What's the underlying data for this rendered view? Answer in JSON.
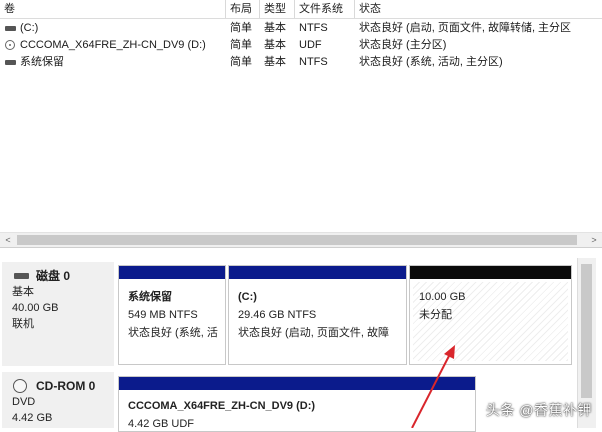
{
  "columns": [
    "卷",
    "布局",
    "类型",
    "文件系统",
    "状态"
  ],
  "volumes": [
    {
      "name": "(C:)",
      "layout": "简单",
      "type": "基本",
      "fs": "NTFS",
      "status": "状态良好 (启动, 页面文件, 故障转储, 主分区",
      "icon": "hdd-icon"
    },
    {
      "name": "CCCOMA_X64FRE_ZH-CN_DV9 (D:)",
      "layout": "简单",
      "type": "基本",
      "fs": "UDF",
      "status": "状态良好 (主分区)",
      "icon": "cd-icon"
    },
    {
      "name": "系统保留",
      "layout": "简单",
      "type": "基本",
      "fs": "NTFS",
      "status": "状态良好 (系统, 活动, 主分区)",
      "icon": "hdd-icon"
    }
  ],
  "scrollbar": {
    "left_arrow": "<",
    "right_arrow": ">"
  },
  "disks": [
    {
      "title": "磁盘 0",
      "type": "基本",
      "size": "40.00 GB",
      "state": "联机",
      "icon": "hdd-icon",
      "partitions": [
        {
          "name": "系统保留",
          "size_fs": "549 MB NTFS",
          "status": "状态良好 (系统, 活"
        },
        {
          "name": "(C:)",
          "size_fs": "29.46 GB NTFS",
          "status": "状态良好 (启动, 页面文件, 故障"
        },
        {
          "name": "",
          "size_fs": "10.00 GB",
          "status": "未分配"
        }
      ]
    },
    {
      "title": "CD-ROM 0",
      "type": "DVD",
      "size": "4.42 GB",
      "icon": "cdrom-icon",
      "partitions": [
        {
          "name": "CCCOMA_X64FRE_ZH-CN_DV9  (D:)",
          "size_fs": "4.42 GB UDF"
        }
      ]
    }
  ],
  "colors": {
    "primary_partition_bar": "#0b1b8c",
    "unallocated_bar": "#0a0a0a",
    "annotation_arrow": "#d9262c"
  },
  "watermark": "头条 @香蕉补钾"
}
